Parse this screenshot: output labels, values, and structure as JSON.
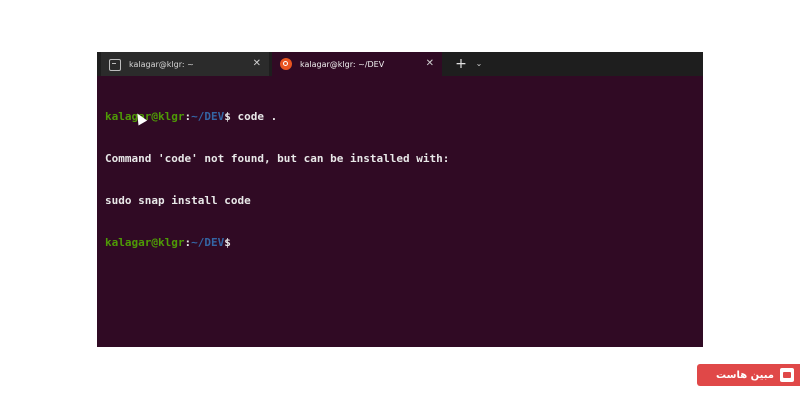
{
  "tabs": [
    {
      "label": "kalagar@klgr: ~",
      "close": "✕",
      "icon": "cmd-icon",
      "active": false
    },
    {
      "label": "kalagar@klgr: ~/DEV",
      "close": "✕",
      "icon": "ubuntu-icon",
      "active": true
    }
  ],
  "tabbar": {
    "new_tab": "+",
    "dropdown": "⌄"
  },
  "terminal": {
    "line1": {
      "user": "kalagar@klgr",
      "sep": ":",
      "path": "~/DEV",
      "symbol": "$",
      "command": " code ."
    },
    "line2": "Command 'code' not found, but can be installed with:",
    "line3": "sudo snap install code",
    "line4": {
      "user": "kalagar@klgr",
      "sep": ":",
      "path": "~/DEV",
      "symbol": "$"
    }
  },
  "colors": {
    "background": "#300a24",
    "prompt_user": "#4e9a06",
    "prompt_path": "#3465a4",
    "watermark": "#e04848"
  },
  "watermark": {
    "text": "مبین هاست",
    "logo": "mobinhost-logo-icon"
  }
}
